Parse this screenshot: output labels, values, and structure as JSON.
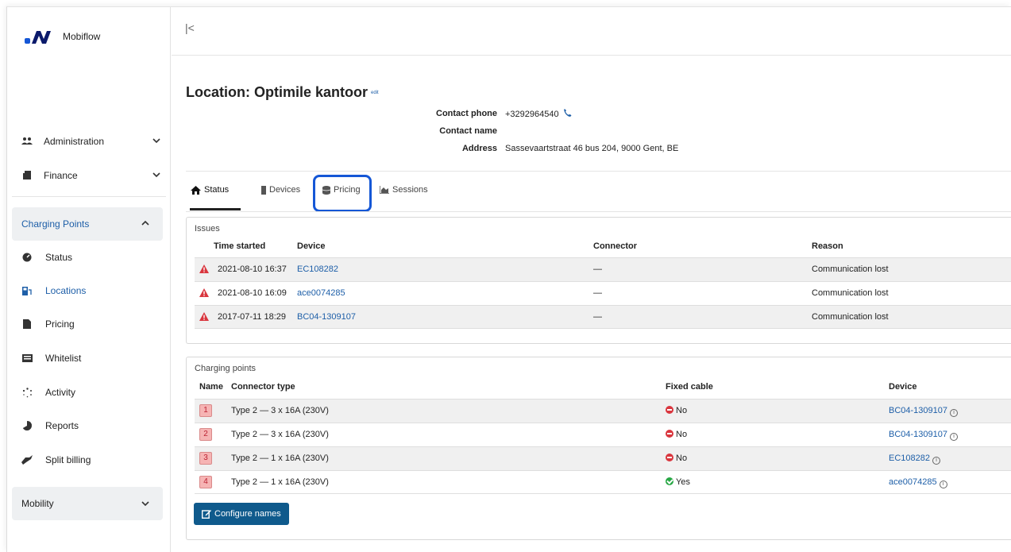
{
  "brand": {
    "name": "Mobiflow"
  },
  "sidebar": {
    "administration": "Administration",
    "finance": "Finance",
    "charging_points": "Charging Points",
    "sub_items": [
      {
        "label": "Status",
        "icon": "status-icon"
      },
      {
        "label": "Locations",
        "icon": "location-icon"
      },
      {
        "label": "Pricing",
        "icon": "pricing-icon"
      },
      {
        "label": "Whitelist",
        "icon": "whitelist-icon"
      },
      {
        "label": "Activity",
        "icon": "activity-icon"
      },
      {
        "label": "Reports",
        "icon": "reports-icon"
      },
      {
        "label": "Split billing",
        "icon": "split-billing-icon"
      }
    ],
    "mobility": "Mobility"
  },
  "topbar": {
    "collapse_glyph": "|<"
  },
  "location": {
    "title": "Location: Optimile kantoor",
    "edit_label": "edit",
    "contact_phone_label": "Contact phone",
    "contact_phone": "+3292964540",
    "contact_name_label": "Contact name",
    "contact_name": "",
    "address_label": "Address",
    "address": "Sassevaartstraat 46 bus 204, 9000 Gent, BE"
  },
  "tabs": {
    "status": "Status",
    "devices": "Devices",
    "pricing": "Pricing",
    "sessions": "Sessions"
  },
  "issues": {
    "title": "Issues",
    "headers": {
      "time": "Time started",
      "device": "Device",
      "connector": "Connector",
      "reason": "Reason"
    },
    "rows": [
      {
        "time": "2021-08-10 16:37",
        "device": "EC108282",
        "connector": "—",
        "reason": "Communication lost"
      },
      {
        "time": "2021-08-10 16:09",
        "device": "ace0074285",
        "connector": "—",
        "reason": "Communication lost"
      },
      {
        "time": "2017-07-11 18:29",
        "device": "BC04-1309107",
        "connector": "—",
        "reason": "Communication lost"
      }
    ]
  },
  "charging_points": {
    "title": "Charging points",
    "headers": {
      "name": "Name",
      "connector": "Connector type",
      "fixed": "Fixed cable",
      "device": "Device"
    },
    "rows": [
      {
        "name": "1",
        "connector": "Type 2 — 3 x 16A (230V)",
        "fixed": "No",
        "device": "BC04-1309107"
      },
      {
        "name": "2",
        "connector": "Type 2 — 3 x 16A (230V)",
        "fixed": "No",
        "device": "BC04-1309107"
      },
      {
        "name": "3",
        "connector": "Type 2 — 1 x 16A (230V)",
        "fixed": "No",
        "device": "EC108282"
      },
      {
        "name": "4",
        "connector": "Type 2 — 1 x 16A (230V)",
        "fixed": "Yes",
        "device": "ace0074285"
      }
    ],
    "configure_label": "Configure names"
  },
  "colors": {
    "accent": "#1e5fa8",
    "button": "#0f5a8c",
    "highlight": "#1557d6",
    "danger": "#d9363e",
    "success": "#28a745"
  }
}
